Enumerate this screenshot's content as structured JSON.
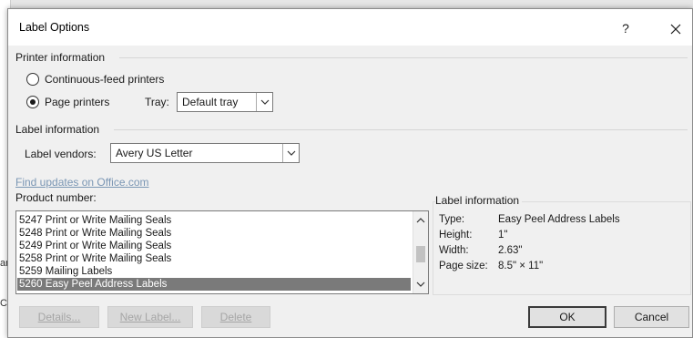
{
  "dialog": {
    "title": "Label Options",
    "help_glyph": "?",
    "close_icon": "close-icon"
  },
  "background": {
    "char_1": "ar",
    "char_2": "C"
  },
  "printer_info": {
    "heading": "Printer information",
    "continuous_label": "Continuous-feed printers",
    "page_label": "Page printers",
    "selected": "page",
    "tray_label": "Tray:",
    "tray_value": "Default tray"
  },
  "label_info": {
    "heading": "Label information",
    "vendors_label": "Label vendors:",
    "vendor_value": "Avery US Letter"
  },
  "find_updates": "Find updates on Office.com",
  "product": {
    "label": "Product number:",
    "items": [
      "5247 Print or Write Mailing Seals",
      "5248 Print or Write Mailing Seals",
      "5249 Print or Write Mailing Seals",
      "5258 Print or Write Mailing Seals",
      "5259 Mailing Labels",
      "5260 Easy Peel Address Labels"
    ],
    "selected_index": 5
  },
  "info_panel": {
    "heading": "Label information",
    "rows": [
      {
        "key": "Type:",
        "value": "Easy Peel Address Labels"
      },
      {
        "key": "Height:",
        "value": "1\""
      },
      {
        "key": "Width:",
        "value": "2.63\""
      },
      {
        "key": "Page size:",
        "value": "8.5\" × 11\""
      }
    ]
  },
  "buttons": {
    "details": "Details...",
    "new_label": "New Label...",
    "delete": "Delete",
    "ok": "OK",
    "cancel": "Cancel"
  },
  "colors": {
    "dialog_bg": "#f0f0f0",
    "selection": "#7a7a7a",
    "link": "#7a96b4"
  }
}
